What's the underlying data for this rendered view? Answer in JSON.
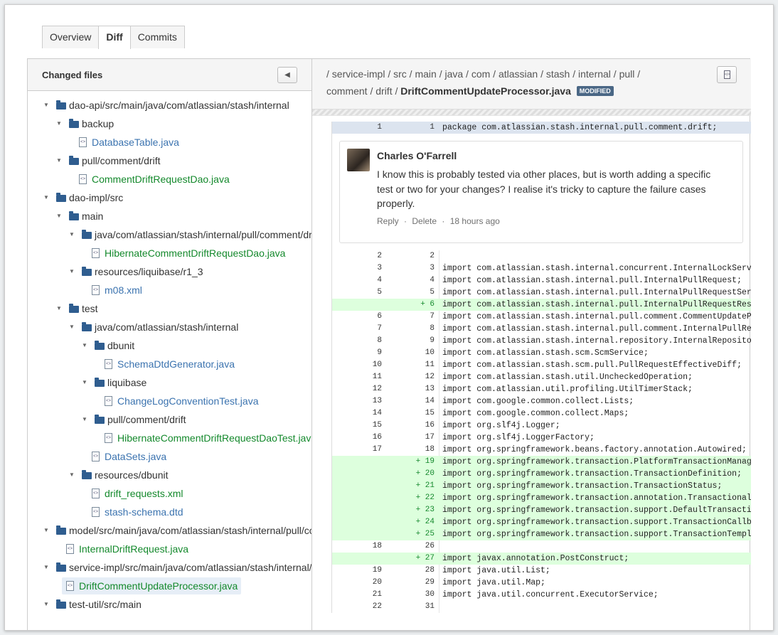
{
  "tabs": [
    "Overview",
    "Diff",
    "Commits"
  ],
  "left": {
    "title": "Changed files",
    "collapse_icon": "◀",
    "tree": [
      {
        "type": "folder",
        "depth": 0,
        "label": "dao-api/src/main/java/com/atlassian/stash/internal"
      },
      {
        "type": "folder",
        "depth": 1,
        "label": "backup"
      },
      {
        "type": "file",
        "depth": 2,
        "label": "DatabaseTable.java",
        "status": "modified"
      },
      {
        "type": "folder",
        "depth": 1,
        "label": "pull/comment/drift"
      },
      {
        "type": "file",
        "depth": 2,
        "label": "CommentDriftRequestDao.java",
        "status": "added"
      },
      {
        "type": "folder",
        "depth": 0,
        "label": "dao-impl/src"
      },
      {
        "type": "folder",
        "depth": 1,
        "label": "main"
      },
      {
        "type": "folder",
        "depth": 2,
        "label": "java/com/atlassian/stash/internal/pull/comment/drift"
      },
      {
        "type": "file",
        "depth": 3,
        "label": "HibernateCommentDriftRequestDao.java",
        "status": "added"
      },
      {
        "type": "folder",
        "depth": 2,
        "label": "resources/liquibase/r1_3"
      },
      {
        "type": "file",
        "depth": 3,
        "label": "m08.xml",
        "status": "modified"
      },
      {
        "type": "folder",
        "depth": 1,
        "label": "test"
      },
      {
        "type": "folder",
        "depth": 2,
        "label": "java/com/atlassian/stash/internal"
      },
      {
        "type": "folder",
        "depth": 3,
        "label": "dbunit"
      },
      {
        "type": "file",
        "depth": 4,
        "label": "SchemaDtdGenerator.java",
        "status": "modified"
      },
      {
        "type": "folder",
        "depth": 3,
        "label": "liquibase"
      },
      {
        "type": "file",
        "depth": 4,
        "label": "ChangeLogConventionTest.java",
        "status": "modified"
      },
      {
        "type": "folder",
        "depth": 3,
        "label": "pull/comment/drift"
      },
      {
        "type": "file",
        "depth": 4,
        "label": "HibernateCommentDriftRequestDaoTest.java",
        "status": "added"
      },
      {
        "type": "file",
        "depth": 3,
        "label": "DataSets.java",
        "status": "modified"
      },
      {
        "type": "folder",
        "depth": 2,
        "label": "resources/dbunit"
      },
      {
        "type": "file",
        "depth": 3,
        "label": "drift_requests.xml",
        "status": "added"
      },
      {
        "type": "file",
        "depth": 3,
        "label": "stash-schema.dtd",
        "status": "modified"
      },
      {
        "type": "folder",
        "depth": 0,
        "label": "model/src/main/java/com/atlassian/stash/internal/pull/comment/drift"
      },
      {
        "type": "file",
        "depth": 1,
        "label": "InternalDriftRequest.java",
        "status": "added"
      },
      {
        "type": "folder",
        "depth": 0,
        "label": "service-impl/src/main/java/com/atlassian/stash/internal/pull/comment/drift"
      },
      {
        "type": "file",
        "depth": 1,
        "label": "DriftCommentUpdateProcessor.java",
        "status": "added",
        "selected": true
      },
      {
        "type": "folder",
        "depth": 0,
        "label": "test-util/src/main"
      }
    ]
  },
  "right": {
    "path_line1": "/ service-impl / src / main / java / com / atlassian / stash / internal / pull /",
    "path_line2_prefix": "comment / drift / ",
    "file_name": "DriftCommentUpdateProcessor.java",
    "status_lozenge": "MODIFIED",
    "raw_icon": "</>",
    "first_line": {
      "old": "1",
      "new": "1",
      "code": "package com.atlassian.stash.internal.pull.comment.drift;"
    },
    "comment": {
      "author": "Charles O'Farrell",
      "text": "I know this is probably tested via other places, but is worth adding a specific test or two for your changes? I realise it's tricky to capture the failure cases properly.",
      "reply": "Reply",
      "delete": "Delete",
      "time": "18 hours ago"
    },
    "lines": [
      {
        "old": "2",
        "new": "2",
        "type": "ctx",
        "code": ""
      },
      {
        "old": "3",
        "new": "3",
        "type": "ctx",
        "code": "import com.atlassian.stash.internal.concurrent.InternalLockService;"
      },
      {
        "old": "4",
        "new": "4",
        "type": "ctx",
        "code": "import com.atlassian.stash.internal.pull.InternalPullRequest;"
      },
      {
        "old": "5",
        "new": "5",
        "type": "ctx",
        "code": "import com.atlassian.stash.internal.pull.InternalPullRequestService;"
      },
      {
        "old": "",
        "new": "+ 6",
        "type": "add",
        "code": "import com.atlassian.stash.internal.pull.InternalPullRequestRescope;"
      },
      {
        "old": "6",
        "new": "7",
        "type": "ctx",
        "code": "import com.atlassian.stash.internal.pull.comment.CommentUpdateProcessor;"
      },
      {
        "old": "7",
        "new": "8",
        "type": "ctx",
        "code": "import com.atlassian.stash.internal.pull.comment.InternalPullRequestComment;"
      },
      {
        "old": "8",
        "new": "9",
        "type": "ctx",
        "code": "import com.atlassian.stash.internal.repository.InternalRepository;"
      },
      {
        "old": "9",
        "new": "10",
        "type": "ctx",
        "code": "import com.atlassian.stash.scm.ScmService;"
      },
      {
        "old": "10",
        "new": "11",
        "type": "ctx",
        "code": "import com.atlassian.stash.scm.pull.PullRequestEffectiveDiff;"
      },
      {
        "old": "11",
        "new": "12",
        "type": "ctx",
        "code": "import com.atlassian.stash.util.UncheckedOperation;"
      },
      {
        "old": "12",
        "new": "13",
        "type": "ctx",
        "code": "import com.atlassian.util.profiling.UtilTimerStack;"
      },
      {
        "old": "13",
        "new": "14",
        "type": "ctx",
        "code": "import com.google.common.collect.Lists;"
      },
      {
        "old": "14",
        "new": "15",
        "type": "ctx",
        "code": "import com.google.common.collect.Maps;"
      },
      {
        "old": "15",
        "new": "16",
        "type": "ctx",
        "code": "import org.slf4j.Logger;"
      },
      {
        "old": "16",
        "new": "17",
        "type": "ctx",
        "code": "import org.slf4j.LoggerFactory;"
      },
      {
        "old": "17",
        "new": "18",
        "type": "ctx",
        "code": "import org.springframework.beans.factory.annotation.Autowired;"
      },
      {
        "old": "",
        "new": "+ 19",
        "type": "add",
        "code": "import org.springframework.transaction.PlatformTransactionManager;"
      },
      {
        "old": "",
        "new": "+ 20",
        "type": "add",
        "code": "import org.springframework.transaction.TransactionDefinition;"
      },
      {
        "old": "",
        "new": "+ 21",
        "type": "add",
        "code": "import org.springframework.transaction.TransactionStatus;"
      },
      {
        "old": "",
        "new": "+ 22",
        "type": "add",
        "code": "import org.springframework.transaction.annotation.Transactional;"
      },
      {
        "old": "",
        "new": "+ 23",
        "type": "add",
        "code": "import org.springframework.transaction.support.DefaultTransactionDefinition;"
      },
      {
        "old": "",
        "new": "+ 24",
        "type": "add",
        "code": "import org.springframework.transaction.support.TransactionCallback;"
      },
      {
        "old": "",
        "new": "+ 25",
        "type": "add",
        "code": "import org.springframework.transaction.support.TransactionTemplate;"
      },
      {
        "old": "18",
        "new": "26",
        "type": "ctx",
        "code": ""
      },
      {
        "old": "",
        "new": "+ 27",
        "type": "add",
        "code": "import javax.annotation.PostConstruct;"
      },
      {
        "old": "19",
        "new": "28",
        "type": "ctx",
        "code": "import java.util.List;"
      },
      {
        "old": "20",
        "new": "29",
        "type": "ctx",
        "code": "import java.util.Map;"
      },
      {
        "old": "21",
        "new": "30",
        "type": "ctx",
        "code": "import java.util.concurrent.ExecutorService;"
      },
      {
        "old": "22",
        "new": "31",
        "type": "ctx",
        "code": ""
      }
    ]
  }
}
